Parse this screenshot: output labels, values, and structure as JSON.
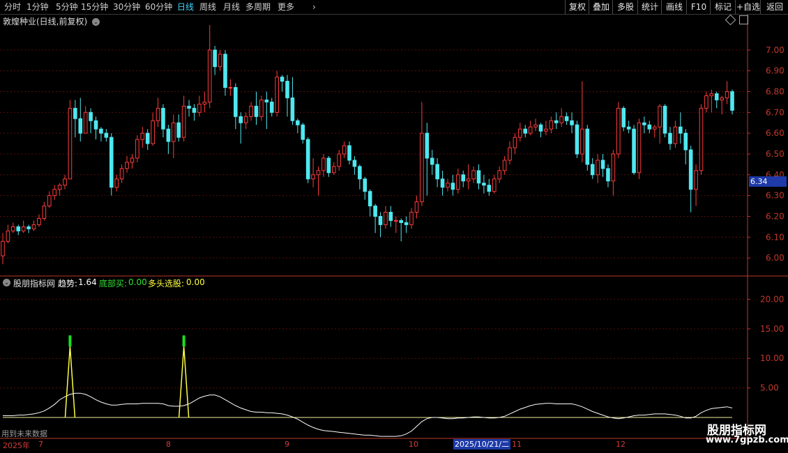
{
  "toolbar": {
    "periods": [
      "分时",
      "1分钟",
      "5分钟",
      "15分钟",
      "30分钟",
      "60分钟",
      "日线",
      "周线",
      "月线",
      "多周期",
      "更多"
    ],
    "active_period": "日线",
    "more_icon": "chevron-right-icon",
    "right_buttons": [
      "复权",
      "叠加",
      "多股",
      "统计",
      "画线",
      "F10",
      "标记",
      "+自选",
      "返回"
    ]
  },
  "chart_title": "敦煌种业(日线,前复权)",
  "current_price_tag": "6.34",
  "indicator": {
    "name": "股朋指标网",
    "trend_label": "趋势:",
    "trend_value": "1.64",
    "bottom_buy_label": "底部买:",
    "bottom_buy_value": "0.00",
    "bull_pick_label": "多头选股:",
    "bull_pick_value": "0.00"
  },
  "future_data_note": "用到未来数据",
  "watermark": {
    "line1": "股朋指标网",
    "line2": "www.7gpzb.com"
  },
  "x_axis": {
    "year": "2025年",
    "months": [
      "7",
      "8",
      "9",
      "10",
      "11",
      "12"
    ],
    "selected_date": "2025/10/21/二"
  },
  "chart_data": {
    "type": "candlestick",
    "price_axis_ticks": [
      "7.00",
      "6.90",
      "6.80",
      "6.70",
      "6.60",
      "6.50",
      "6.40",
      "6.30",
      "6.20",
      "6.10",
      "6.00"
    ],
    "indicator_axis_ticks": [
      "20.00",
      "15.00",
      "10.00",
      "5.00"
    ],
    "ylim": [
      5.92,
      7.12
    ],
    "indicator_ylim": [
      0,
      23
    ],
    "colors": {
      "up": "#ff3c3c",
      "down": "#4fe8f0",
      "grid": "#5a0d0d",
      "axis": "#c0392b",
      "trend": "#ffffff",
      "signal": "#ffff40",
      "signal_cap": "#19e019",
      "baseline": "#f0f0a0"
    },
    "candles": [
      [
        6.01,
        6.08,
        6.12,
        5.97
      ],
      [
        6.08,
        6.13,
        6.16,
        6.07
      ],
      [
        6.13,
        6.15,
        6.17,
        6.12
      ],
      [
        6.15,
        6.13,
        6.16,
        6.11
      ],
      [
        6.13,
        6.15,
        6.18,
        6.12
      ],
      [
        6.15,
        6.14,
        6.16,
        6.12
      ],
      [
        6.14,
        6.16,
        6.18,
        6.13
      ],
      [
        6.16,
        6.19,
        6.21,
        6.15
      ],
      [
        6.19,
        6.25,
        6.27,
        6.18
      ],
      [
        6.25,
        6.3,
        6.32,
        6.24
      ],
      [
        6.3,
        6.33,
        6.35,
        6.28
      ],
      [
        6.33,
        6.35,
        6.36,
        6.3
      ],
      [
        6.35,
        6.38,
        6.4,
        6.33
      ],
      [
        6.38,
        6.72,
        6.76,
        6.38
      ],
      [
        6.72,
        6.67,
        6.76,
        6.58
      ],
      [
        6.67,
        6.6,
        6.77,
        6.56
      ],
      [
        6.6,
        6.7,
        6.73,
        6.6
      ],
      [
        6.7,
        6.66,
        6.72,
        6.6
      ],
      [
        6.66,
        6.62,
        6.68,
        6.57
      ],
      [
        6.62,
        6.6,
        6.63,
        6.56
      ],
      [
        6.6,
        6.58,
        6.62,
        6.56
      ],
      [
        6.58,
        6.34,
        6.6,
        6.3
      ],
      [
        6.34,
        6.38,
        6.4,
        6.32
      ],
      [
        6.38,
        6.43,
        6.45,
        6.36
      ],
      [
        6.43,
        6.46,
        6.49,
        6.41
      ],
      [
        6.46,
        6.48,
        6.5,
        6.43
      ],
      [
        6.48,
        6.57,
        6.59,
        6.46
      ],
      [
        6.57,
        6.6,
        6.63,
        6.53
      ],
      [
        6.6,
        6.55,
        6.62,
        6.52
      ],
      [
        6.55,
        6.66,
        6.7,
        6.54
      ],
      [
        6.66,
        6.72,
        6.77,
        6.63
      ],
      [
        6.72,
        6.62,
        6.74,
        6.58
      ],
      [
        6.62,
        6.56,
        6.64,
        6.5
      ],
      [
        6.56,
        6.65,
        6.69,
        6.48
      ],
      [
        6.65,
        6.58,
        6.69,
        6.56
      ],
      [
        6.58,
        6.73,
        6.78,
        6.56
      ],
      [
        6.73,
        6.72,
        6.76,
        6.68
      ],
      [
        6.72,
        6.7,
        6.74,
        6.66
      ],
      [
        6.7,
        6.74,
        6.78,
        6.68
      ],
      [
        6.74,
        6.75,
        6.8,
        6.7
      ],
      [
        6.75,
        7.0,
        7.12,
        6.72
      ],
      [
        7.0,
        6.92,
        7.02,
        6.88
      ],
      [
        6.92,
        6.98,
        7.0,
        6.9
      ],
      [
        6.98,
        6.82,
        7.0,
        6.78
      ],
      [
        6.82,
        6.82,
        6.86,
        6.78
      ],
      [
        6.82,
        6.68,
        6.84,
        6.62
      ],
      [
        6.68,
        6.65,
        6.7,
        6.55
      ],
      [
        6.65,
        6.68,
        6.7,
        6.62
      ],
      [
        6.68,
        6.73,
        6.75,
        6.66
      ],
      [
        6.73,
        6.68,
        6.8,
        6.64
      ],
      [
        6.68,
        6.76,
        6.78,
        6.66
      ],
      [
        6.76,
        6.75,
        6.8,
        6.62
      ],
      [
        6.75,
        6.7,
        6.77,
        6.68
      ],
      [
        6.7,
        6.87,
        6.9,
        6.68
      ],
      [
        6.87,
        6.85,
        6.88,
        6.8
      ],
      [
        6.85,
        6.77,
        6.88,
        6.68
      ],
      [
        6.77,
        6.66,
        6.87,
        6.64
      ],
      [
        6.66,
        6.64,
        6.67,
        6.6
      ],
      [
        6.64,
        6.57,
        6.65,
        6.55
      ],
      [
        6.57,
        6.38,
        6.58,
        6.36
      ],
      [
        6.38,
        6.4,
        6.48,
        6.34
      ],
      [
        6.4,
        6.42,
        6.44,
        6.3
      ],
      [
        6.42,
        6.48,
        6.5,
        6.39
      ],
      [
        6.48,
        6.41,
        6.49,
        6.39
      ],
      [
        6.41,
        6.44,
        6.46,
        6.4
      ],
      [
        6.44,
        6.5,
        6.52,
        6.42
      ],
      [
        6.5,
        6.54,
        6.56,
        6.48
      ],
      [
        6.54,
        6.47,
        6.56,
        6.45
      ],
      [
        6.47,
        6.44,
        6.49,
        6.4
      ],
      [
        6.44,
        6.38,
        6.45,
        6.33
      ],
      [
        6.38,
        6.32,
        6.39,
        6.28
      ],
      [
        6.32,
        6.25,
        6.33,
        6.2
      ],
      [
        6.25,
        6.2,
        6.26,
        6.12
      ],
      [
        6.2,
        6.16,
        6.22,
        6.1
      ],
      [
        6.16,
        6.22,
        6.25,
        6.14
      ],
      [
        6.22,
        6.18,
        6.25,
        6.15
      ],
      [
        6.18,
        6.18,
        6.2,
        6.12
      ],
      [
        6.18,
        6.17,
        6.19,
        6.08
      ],
      [
        6.17,
        6.16,
        6.2,
        6.12
      ],
      [
        6.16,
        6.22,
        6.24,
        6.14
      ],
      [
        6.22,
        6.27,
        6.3,
        6.19
      ],
      [
        6.27,
        6.6,
        6.75,
        6.25
      ],
      [
        6.6,
        6.48,
        6.65,
        6.3
      ],
      [
        6.48,
        6.45,
        6.52,
        6.4
      ],
      [
        6.45,
        6.38,
        6.48,
        6.34
      ],
      [
        6.38,
        6.34,
        6.42,
        6.3
      ],
      [
        6.34,
        6.36,
        6.38,
        6.32
      ],
      [
        6.36,
        6.33,
        6.4,
        6.3
      ],
      [
        6.33,
        6.4,
        6.43,
        6.31
      ],
      [
        6.4,
        6.37,
        6.42,
        6.34
      ],
      [
        6.37,
        6.38,
        6.45,
        6.33
      ],
      [
        6.38,
        6.42,
        6.44,
        6.36
      ],
      [
        6.42,
        6.36,
        6.45,
        6.33
      ],
      [
        6.36,
        6.35,
        6.4,
        6.31
      ],
      [
        6.35,
        6.32,
        6.38,
        6.3
      ],
      [
        6.32,
        6.38,
        6.4,
        6.31
      ],
      [
        6.38,
        6.42,
        6.44,
        6.36
      ],
      [
        6.42,
        6.47,
        6.49,
        6.4
      ],
      [
        6.47,
        6.53,
        6.56,
        6.45
      ],
      [
        6.53,
        6.58,
        6.6,
        6.5
      ],
      [
        6.58,
        6.62,
        6.65,
        6.56
      ],
      [
        6.62,
        6.6,
        6.64,
        6.58
      ],
      [
        6.6,
        6.63,
        6.66,
        6.59
      ],
      [
        6.63,
        6.64,
        6.67,
        6.61
      ],
      [
        6.64,
        6.61,
        6.65,
        6.58
      ],
      [
        6.61,
        6.62,
        6.66,
        6.59
      ],
      [
        6.62,
        6.66,
        6.68,
        6.6
      ],
      [
        6.66,
        6.65,
        6.7,
        6.62
      ],
      [
        6.65,
        6.68,
        6.72,
        6.63
      ],
      [
        6.68,
        6.66,
        6.7,
        6.64
      ],
      [
        6.66,
        6.64,
        6.7,
        6.6
      ],
      [
        6.64,
        6.5,
        6.66,
        6.48
      ],
      [
        6.5,
        6.62,
        6.85,
        6.46
      ],
      [
        6.62,
        6.45,
        6.64,
        6.42
      ],
      [
        6.45,
        6.4,
        6.48,
        6.38
      ],
      [
        6.4,
        6.47,
        6.5,
        6.36
      ],
      [
        6.47,
        6.43,
        6.5,
        6.39
      ],
      [
        6.43,
        6.37,
        6.45,
        6.34
      ],
      [
        6.37,
        6.5,
        6.52,
        6.3
      ],
      [
        6.5,
        6.72,
        6.75,
        6.48
      ],
      [
        6.72,
        6.63,
        6.73,
        6.61
      ],
      [
        6.63,
        6.62,
        6.66,
        6.6
      ],
      [
        6.62,
        6.41,
        6.64,
        6.4
      ],
      [
        6.41,
        6.65,
        6.67,
        6.38
      ],
      [
        6.65,
        6.64,
        6.68,
        6.6
      ],
      [
        6.64,
        6.62,
        6.66,
        6.6
      ],
      [
        6.62,
        6.63,
        6.64,
        6.58
      ],
      [
        6.63,
        6.73,
        6.74,
        6.55
      ],
      [
        6.73,
        6.6,
        6.74,
        6.58
      ],
      [
        6.6,
        6.55,
        6.63,
        6.52
      ],
      [
        6.55,
        6.63,
        6.66,
        6.53
      ],
      [
        6.63,
        6.6,
        6.7,
        6.55
      ],
      [
        6.6,
        6.52,
        6.62,
        6.45
      ],
      [
        6.52,
        6.33,
        6.54,
        6.22
      ],
      [
        6.33,
        6.42,
        6.45,
        6.25
      ],
      [
        6.42,
        6.72,
        6.74,
        6.4
      ],
      [
        6.72,
        6.78,
        6.8,
        6.7
      ],
      [
        6.78,
        6.79,
        6.81,
        6.7
      ],
      [
        6.79,
        6.76,
        6.8,
        6.72
      ],
      [
        6.76,
        6.77,
        6.78,
        6.69
      ],
      [
        6.77,
        6.8,
        6.85,
        6.74
      ],
      [
        6.8,
        6.71,
        6.81,
        6.69
      ]
    ],
    "trend": [
      0.3,
      0.3,
      0.3,
      0.4,
      0.4,
      0.5,
      0.6,
      0.8,
      1.1,
      1.6,
      2.2,
      3.0,
      3.5,
      3.9,
      4.1,
      4.1,
      3.9,
      3.5,
      3.0,
      2.6,
      2.3,
      2.1,
      2.1,
      2.2,
      2.3,
      2.3,
      2.3,
      2.4,
      2.4,
      2.4,
      2.4,
      2.3,
      2.0,
      1.9,
      1.9,
      2.0,
      2.3,
      2.8,
      3.3,
      3.6,
      3.8,
      3.8,
      3.5,
      3.0,
      2.5,
      2.0,
      1.6,
      1.3,
      1.0,
      0.9,
      0.9,
      0.8,
      0.8,
      0.7,
      0.6,
      0.4,
      0.1,
      -0.3,
      -0.8,
      -1.3,
      -1.7,
      -2.0,
      -2.2,
      -2.3,
      -2.4,
      -2.5,
      -2.6,
      -2.7,
      -2.8,
      -2.9,
      -3.0,
      -3.0,
      -3.1,
      -3.2,
      -3.2,
      -3.2,
      -3.2,
      -3.1,
      -2.8,
      -2.3,
      -1.5,
      -0.7,
      -0.2,
      0.0,
      0.0,
      -0.1,
      -0.2,
      -0.2,
      -0.1,
      -0.1,
      0.0,
      0.1,
      0.1,
      0.0,
      -0.1,
      -0.1,
      0.0,
      0.2,
      0.6,
      1.0,
      1.4,
      1.7,
      2.0,
      2.2,
      2.3,
      2.4,
      2.4,
      2.3,
      2.3,
      2.3,
      2.3,
      2.1,
      1.8,
      1.4,
      1.0,
      0.7,
      0.4,
      0.1,
      -0.1,
      -0.2,
      -0.1,
      0.1,
      0.3,
      0.4,
      0.4,
      0.5,
      0.6,
      0.6,
      0.6,
      0.5,
      0.4,
      0.2,
      -0.1,
      -0.1,
      0.2,
      0.8,
      1.2,
      1.5,
      1.6,
      1.7,
      1.8,
      1.6
    ],
    "signal_spikes": [
      {
        "candle_index": 13,
        "value": 12.0
      },
      {
        "candle_index": 35,
        "value": 12.0
      }
    ],
    "baseline": 0
  }
}
